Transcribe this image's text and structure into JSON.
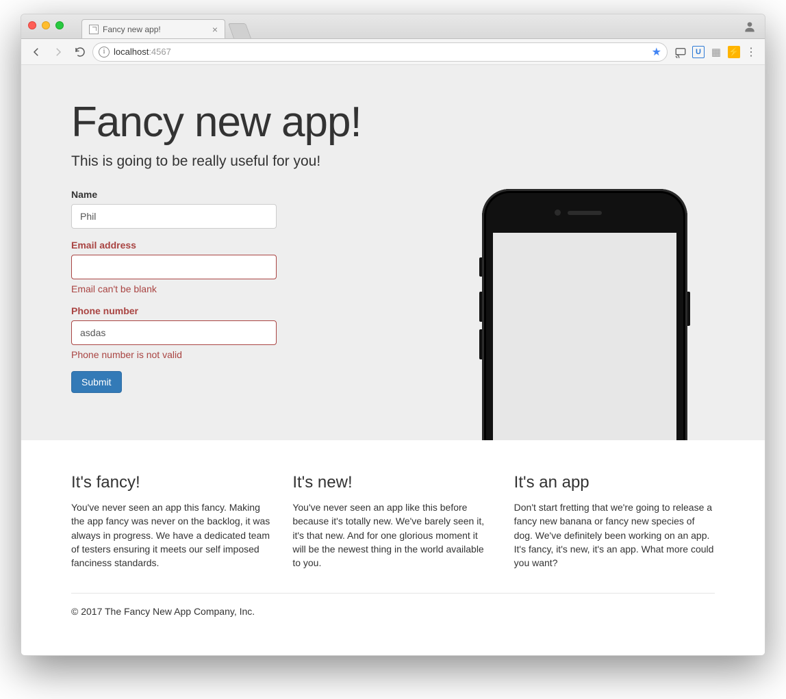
{
  "browser": {
    "tab_title": "Fancy new app!",
    "url_host": "localhost",
    "url_port": ":4567"
  },
  "page": {
    "title": "Fancy new app!",
    "subtitle": "This is going to be really useful for you!",
    "form": {
      "name": {
        "label": "Name",
        "value": "Phil"
      },
      "email": {
        "label": "Email address",
        "value": "",
        "error": "Email can't be blank"
      },
      "phone": {
        "label": "Phone number",
        "value": "asdas",
        "error": "Phone number is not valid"
      },
      "submit": "Submit"
    },
    "features": [
      {
        "heading": "It's fancy!",
        "body": "You've never seen an app this fancy. Making the app fancy was never on the backlog, it was always in progress. We have a dedicated team of testers ensuring it meets our self imposed fanciness standards."
      },
      {
        "heading": "It's new!",
        "body": "You've never seen an app like this before because it's totally new. We've barely seen it, it's that new. And for one glorious moment it will be the newest thing in the world available to you."
      },
      {
        "heading": "It's an app",
        "body": "Don't start fretting that we're going to release a fancy new banana or fancy new species of dog. We've definitely been working on an app. It's fancy, it's new, it's an app. What more could you want?"
      }
    ],
    "footer": "© 2017 The Fancy New App Company, Inc."
  }
}
